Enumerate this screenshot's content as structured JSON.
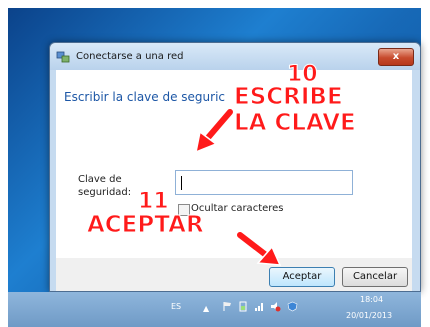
{
  "dialog": {
    "title": "Conectarse a una red",
    "close_label": "x",
    "heading": "Escribir la clave de seguric",
    "security_key_label": "Clave de seguridad:",
    "security_key_value": "",
    "hide_characters_label": "Ocultar caracteres",
    "hide_characters_checked": false,
    "ok_label": "Aceptar",
    "cancel_label": "Cancelar"
  },
  "annotations": {
    "step_10_number": "10",
    "step_10_line1": "ESCRIBE",
    "step_10_line2": "LA CLAVE",
    "step_11_number": "11",
    "step_11_text": "ACEPTAR",
    "color": "#ff1a1a"
  },
  "taskbar": {
    "language": "ES",
    "time": "18:04",
    "date": "20/01/2013",
    "tray_icons": [
      "flag-icon",
      "battery-icon",
      "network-icon",
      "volume-icon",
      "shield-icon"
    ]
  },
  "colors": {
    "heading_blue": "#1d57a6",
    "close_red": "#c74b2d"
  }
}
